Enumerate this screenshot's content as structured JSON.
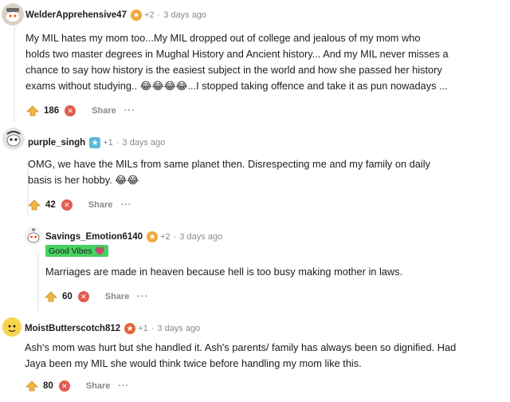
{
  "comments": [
    {
      "username": "WelderApprehensive47",
      "award_count": "+2",
      "separator": "·",
      "time": "3 days ago",
      "text_lines": [
        "My MIL hates my mom too...My MIL dropped out of college and jealous of my mom who",
        "holds two master degrees in Mughal History and Ancient history... And my MIL never misses a",
        "chance to say how history is the easiest subject in the world and how she passed her history",
        "exams without studying.. 😂😂😂😂...I stopped taking offence and take it as pun nowadays ..."
      ],
      "score": "186",
      "share_label": "Share",
      "more_label": "···"
    },
    {
      "username": "purple_singh",
      "award_count": "+1",
      "separator": "·",
      "time": "3 days ago",
      "text_lines": [
        "OMG, we have the MILs from same planet then. Disrespecting me and my family on daily",
        "basis is her hobby. 😂😂"
      ],
      "score": "42",
      "share_label": "Share",
      "more_label": "···"
    },
    {
      "username": "Savings_Emotion6140",
      "award_count": "+2",
      "separator": "·",
      "time": "3 days ago",
      "flair": "Good Vibes 💗",
      "text_lines": [
        "Marriages are made in heaven because hell is too busy making mother in laws."
      ],
      "score": "60",
      "share_label": "Share",
      "more_label": "···"
    },
    {
      "username": "MoistButterscotch812",
      "award_count": "+1",
      "separator": "·",
      "time": "3 days ago",
      "text_lines": [
        "Ash's mom was hurt but she handled it. Ash's parents/ family has always been so dignified. Had",
        "Jaya been my MIL she would think twice before handling my mom like this."
      ],
      "score": "80",
      "share_label": "Share",
      "more_label": "···"
    }
  ],
  "colors": {
    "downvote": "#e35b4f",
    "upvote": "#f2b544",
    "flair_bg": "#46d160",
    "muted": "#878a8c"
  }
}
